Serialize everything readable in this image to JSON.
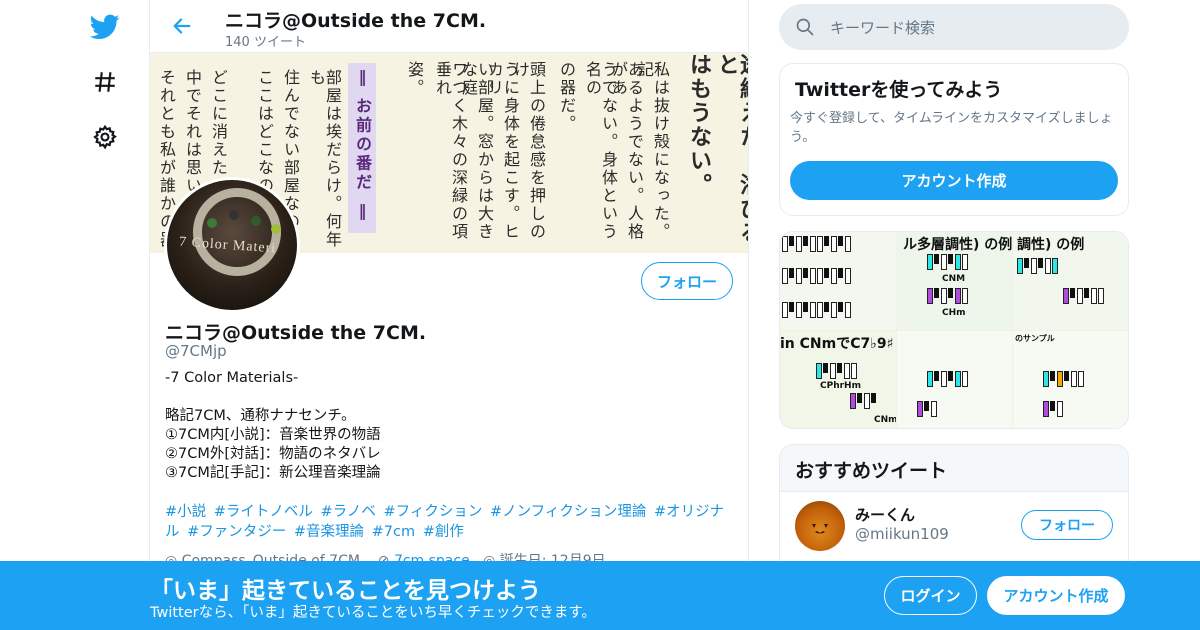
{
  "nav": {
    "icons": [
      "twitter-bird-icon",
      "hashtag-icon",
      "gear-icon"
    ],
    "brand_color": "#1da1f2"
  },
  "header": {
    "name": "ニコラ@Outside the 7CM.",
    "tweet_count": "140 ツイート"
  },
  "banner": {
    "columns": [
      "途絶えた。浴びると",
      "はもうない。",
      "私は抜け殻になった。記",
      "あるようでない。人格があ",
      "うでない。身体という名の",
      "の器だ。",
      "頭上の倦怠感を押しのけ",
      "うに身体を起こす。ヒカリ",
      "い部屋。窓からは大きな庭",
      "ワつく木々の深緑の項垂れ",
      "姿。",
      "部屋は埃だらけ。何年も",
      "住んでない部屋なの",
      "ここはどこなのか",
      "どこに消えたの",
      "中でそれは思い出",
      "それとも私が誰かの器"
    ],
    "heading": "‖ お前の番だ ‖"
  },
  "avatar": {
    "label": "7 Color Materi"
  },
  "profile": {
    "follow_label": "フォロー",
    "name": "ニコラ@Outside the 7CM.",
    "handle": "@7CMjp",
    "bio": {
      "line1": "-7 Color Materials-",
      "line2": "略記7CM、通称ナナセンチ。",
      "line3": "①7CM内[小説]：音楽世界の物語",
      "line4": "②7CM外[対話]：物語のネタバレ",
      "line5": "③7CM記[手記]：新公理音楽理論"
    },
    "hashtags": [
      "#小説",
      "#ライトノベル",
      "#ラノベ",
      "#フィクション",
      "#ノンフィクション理論",
      "#オリジナル",
      "#ファンタジー",
      "#音楽理論",
      "#7cm",
      "#創作"
    ],
    "location": "Compass_Outside of 7CM.",
    "website": "7cm.space",
    "birthday": "誕生日: 12月9日"
  },
  "search": {
    "placeholder": "キーワード検索"
  },
  "try_card": {
    "title": "Twitterを使ってみよう",
    "description": "今すぐ登録して、タイムラインをカスタマイズしましょう。",
    "button": "アカウント作成"
  },
  "media": {
    "text1": "ル多層調性) の例",
    "text2": "調性) の例",
    "text3": "in CNmでC7♭9♯",
    "text4": "CNM",
    "text5": "CHm",
    "text6": "CPhrHm",
    "text7": "CNm",
    "text8": "のサンプル"
  },
  "reco": {
    "title": "おすすめツイート",
    "name": "みーくん",
    "handle": "@miikun109",
    "follow_label": "フォロー"
  },
  "bottom_bar": {
    "title": "「いま」起きていることを見つけよう",
    "subtitle": "Twitterなら、「いま」起きていることをいち早くチェックできます。",
    "login": "ログイン",
    "signup": "アカウント作成"
  }
}
